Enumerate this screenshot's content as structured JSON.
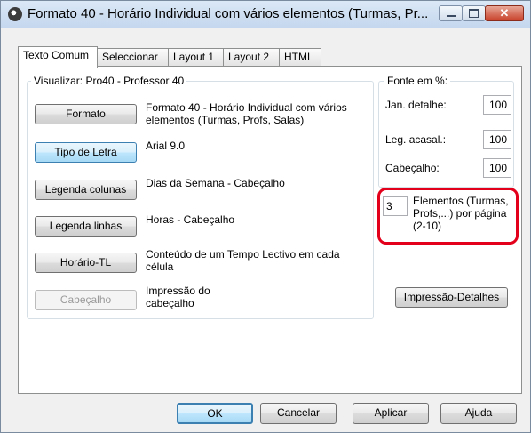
{
  "window": {
    "title": "Formato 40 - Horário Individual com vários elementos (Turmas, Pr...",
    "icon": "app-globe-icon"
  },
  "titlebar_buttons": {
    "minimize": "minimize-icon",
    "maximize": "maximize-icon",
    "close": "✕"
  },
  "tabs": [
    {
      "label": "Texto Comum",
      "active": true
    },
    {
      "label": "Seleccionar",
      "active": false
    },
    {
      "label": "Layout 1",
      "active": false
    },
    {
      "label": "Layout 2",
      "active": false
    },
    {
      "label": "HTML",
      "active": false
    }
  ],
  "visualizar": {
    "legend": "Visualizar: Pro40 - Professor 40",
    "rows": [
      {
        "button": "Formato",
        "desc": "Formato 40 - Horário Individual com vários elementos (Turmas, Profs, Salas)",
        "enabled": true,
        "focused": false
      },
      {
        "button": "Tipo de Letra",
        "desc": "Arial 9.0",
        "enabled": true,
        "focused": true
      },
      {
        "button": "Legenda colunas",
        "desc": "Dias da Semana - Cabeçalho",
        "enabled": true,
        "focused": false
      },
      {
        "button": "Legenda linhas",
        "desc": "Horas - Cabeçalho",
        "enabled": true,
        "focused": false
      },
      {
        "button": "Horário-TL",
        "desc": "Conteúdo de um Tempo Lectivo em cada célula",
        "enabled": true,
        "focused": false
      },
      {
        "button": "Cabeçalho",
        "desc": "Impressão do cabeçalho",
        "enabled": false,
        "focused": false
      }
    ]
  },
  "fonte": {
    "legend": "Fonte em %:",
    "fields": [
      {
        "label": "Jan. detalhe:",
        "value": "100"
      },
      {
        "label": "Leg. acasal.:",
        "value": "100"
      },
      {
        "label": "Cabeçalho:",
        "value": "100"
      }
    ]
  },
  "elementos": {
    "value": "3",
    "label": "Elementos (Turmas, Profs,...) por página (2-10)"
  },
  "impressao_button": "Impressão-Detalhes",
  "footer": {
    "ok": "OK",
    "cancel": "Cancelar",
    "apply": "Aplicar",
    "help": "Ajuda"
  },
  "colors": {
    "highlight": "#e3001b",
    "focus_button": "#a7d9f5"
  }
}
